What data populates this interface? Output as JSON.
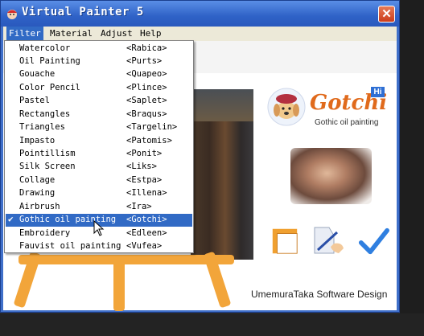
{
  "window": {
    "title": "Virtual Painter 5",
    "close_glyph": "✕"
  },
  "menubar": {
    "items": [
      "Filter",
      "Material",
      "Adjust",
      "Help"
    ],
    "active": "Filter"
  },
  "filter_menu": {
    "items": [
      {
        "name": "Watercolor",
        "code": "<Rabica>"
      },
      {
        "name": "Oil Painting",
        "code": "<Purts>"
      },
      {
        "name": "Gouache",
        "code": "<Quapeo>"
      },
      {
        "name": "Color Pencil",
        "code": "<Plince>"
      },
      {
        "name": "Pastel",
        "code": "<Saplet>"
      },
      {
        "name": "Rectangles",
        "code": "<Braqus>"
      },
      {
        "name": "Triangles",
        "code": "<Targelin>"
      },
      {
        "name": "Impasto",
        "code": "<Patomis>"
      },
      {
        "name": "Pointillism",
        "code": "<Ponit>"
      },
      {
        "name": "Silk Screen",
        "code": "<Liks>"
      },
      {
        "name": "Collage",
        "code": "<Estpa>"
      },
      {
        "name": "Drawing",
        "code": "<Illena>"
      },
      {
        "name": "Airbrush",
        "code": "<Ira>"
      },
      {
        "name": "Gothic oil painting",
        "code": "<Gotchi>",
        "checked": true
      },
      {
        "name": "Embroidery",
        "code": "<Edleen>"
      },
      {
        "name": "Fauvist oil painting",
        "code": "<Vufea>"
      }
    ],
    "check_glyph": "✔"
  },
  "logo": {
    "name": "Gotchi",
    "badge": "Hi",
    "subtitle": "Gothic oil painting"
  },
  "credit": "UmemuraTaka Software Design",
  "colors": {
    "titlebar": "#2f62c7",
    "highlight": "#316ac5",
    "easel": "#f2a53a",
    "logo": "#e06a1c"
  },
  "icons": [
    "app-icon",
    "close-icon",
    "frame-icon",
    "pen-hand-icon",
    "checkmark-icon",
    "mouse-cursor-icon"
  ]
}
